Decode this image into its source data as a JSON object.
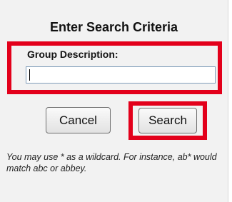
{
  "dialog": {
    "title": "Enter Search Criteria",
    "field_label": "Group Description:",
    "field_value": "",
    "cancel_label": "Cancel",
    "search_label": "Search",
    "help_text": "You may use * as a wildcard. For instance, ab* would match abc or abbey."
  },
  "colors": {
    "highlight": "#e3001b",
    "panel_background": "#f2f2f2"
  }
}
